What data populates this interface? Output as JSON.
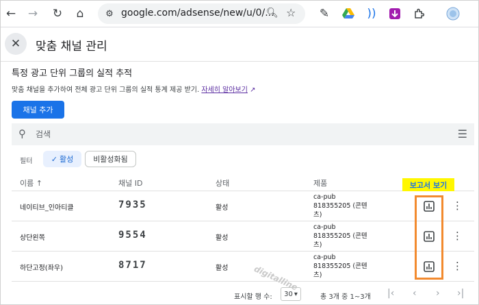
{
  "browser": {
    "url": "google.com/adsense/new/u/0/...",
    "icons": [
      "back-icon",
      "forward-icon",
      "reload-icon",
      "home-icon",
      "site-info-icon",
      "zoom-icon",
      "star-icon",
      "pencil-icon",
      "drive-icon",
      "audio-icon",
      "download-icon",
      "extensions-icon",
      "profile-icon"
    ]
  },
  "dialog": {
    "title": "맞춤 채널 관리",
    "section_title": "특정 광고 단위 그룹의 실적 추적",
    "section_desc": "맞춤 채널을 추가하여 전체 광고 단위 그룹의 실적 통계 제공 받기.",
    "learn_more": "자세히 알아보기",
    "add_button": "채널 추가",
    "search_placeholder": "검색",
    "filter_label": "필터",
    "filter_active": "활성",
    "filter_inactive": "비활성화됨",
    "columns": {
      "name": "이름 ↑",
      "id": "채널 ID",
      "status": "상태",
      "product": "제품"
    },
    "report_label": "보고서 보기",
    "rows": [
      {
        "name": "네이티브_인아티클",
        "id": "7935",
        "status": "활성",
        "product_l1": "ca-pub",
        "product_l2": "818355205 (콘텐",
        "product_l3": "츠)"
      },
      {
        "name": "상단왼쪽",
        "id": "9554",
        "status": "활성",
        "product_l1": "ca-pub",
        "product_l2": "818355205 (콘텐",
        "product_l3": "츠)"
      },
      {
        "name": "하단고정(좌우)",
        "id": "8717",
        "status": "활성",
        "product_l1": "ca-pub",
        "product_l2": "818355205 (콘텐",
        "product_l3": "츠)"
      }
    ]
  },
  "pager": {
    "rows_label": "표시할 행 수:",
    "rows_value": "30",
    "count": "총 3개 중 1~3개"
  },
  "watermark": "digitalline",
  "colors": {
    "primary": "#1a73e8",
    "highlight_border": "#f28a2e",
    "highlight_label_bg": "#fff700"
  }
}
